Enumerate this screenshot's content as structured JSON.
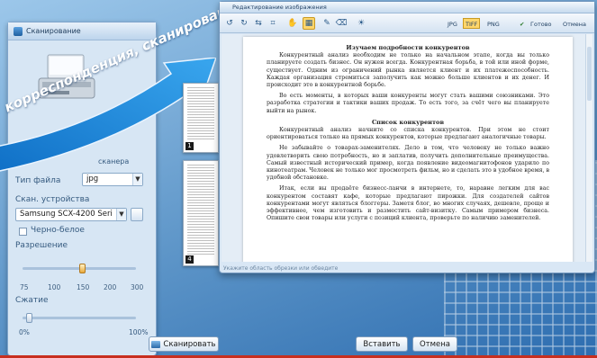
{
  "colors": {
    "accent": "#ffd66b",
    "banner": "#1e88d8",
    "footer": "#c82f1f"
  },
  "scan_window": {
    "title": "Сканирование",
    "file_type_label": "Тип файла",
    "file_type_value": "jpg",
    "device_label": "Скан. устройства",
    "device_value": "Samsung SCX-4200 Seri",
    "device_header_partial": "сканера",
    "bw_label": "Черно-белое",
    "resolution_label": "Разрешение",
    "resolution_value": 150,
    "resolution_ticks": [
      "75",
      "100",
      "150",
      "200",
      "300"
    ],
    "compression_label": "Сжатие",
    "compression_value": 0,
    "compression_min": "0%",
    "compression_max": "100%",
    "scan_button": "Сканировать"
  },
  "banner": {
    "text": "корреспонденция, сканирование"
  },
  "thumbnails": [
    {
      "number": "1"
    },
    {
      "number": "4"
    }
  ],
  "editor": {
    "title": "Редактирование изображения",
    "icons": [
      "rotate-left-icon",
      "rotate-right-icon",
      "flip-icon",
      "crop-icon",
      "hand-icon",
      "select-icon",
      "brush-icon",
      "eraser-icon",
      "sun-icon"
    ],
    "formats": [
      "JPG",
      "TIFF",
      "PNG"
    ],
    "active_format": "TIFF",
    "ok_label": "Готово",
    "cancel_label": "Отмена",
    "status": "Укажите область обрезки или обведите",
    "document": {
      "heading1": "Изучаем подробности конкурентов",
      "para1": "Конкурентный анализ необходим не только на начальном этапе, когда вы только планируете создать бизнес. Он нужен всегда. Конкурентная борьба, в той или иной форме, существует. Одним из ограничений рынка является клиент и их платежеспособность. Каждая организация стремиться заполучить как можно больше клиентов и их денег. И происходит это в конкурентной борьбе.",
      "para2": "Во есть моменты, в которых ваши конкуренты могут стать вашими союзниками. Это разработка стратегии и тактики ваших продаж. То есть того, за счёт чего вы планируете выйти на рынок.",
      "heading2": "Список конкурентов",
      "para3": "Конкурентный анализ начните со списка конкурентов. При этом не стоит ориентироваться только на прямых конкурентов, которые предлагают аналогичные товары.",
      "para4": "Не забывайте о товарах-заменителях. Дело в том, что человеку не только важно удовлетворить свою потребность, но и заплатив, получить дополнительные преимущества. Самый известный исторический пример, когда появление видеомагнитофонов ударило по кинотеатрам. Человек не только мог просмотреть фильм, но и сделать это в удобное время, в удобной обстановке.",
      "para5": "Итак, если вы продаёте бизнесс-ланчи в интернете, то, наравне легким для вас конкурентом составят кафе, которые предлагают пирожки. Для создателей сайтов конкурентами могут являться блоггеры. Заметя блог, во многих случаях, дешевле, проще и эффективнее, чем изготовить и разместить сайт-визитку. Самым примером бизнеса. Опишите свои товары или услуги с позиций клиента, проверьте по наличию заменителей."
    }
  },
  "bottom_buttons": {
    "insert": "Вставить",
    "cancel": "Отмена"
  }
}
